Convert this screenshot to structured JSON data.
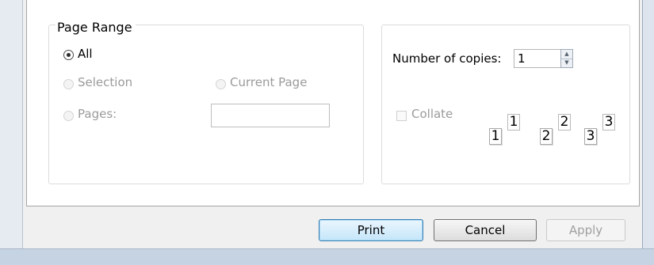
{
  "dialog": {
    "page_range": {
      "title": "Page Range",
      "options": {
        "all": "All",
        "selection": "Selection",
        "current_page": "Current Page",
        "pages": "Pages:"
      },
      "selected": "all",
      "pages_value": ""
    },
    "copies": {
      "label": "Number of copies:",
      "value": "1",
      "collate_label": "Collate",
      "collate_checked": false,
      "collate_pages": [
        "1",
        "1",
        "2",
        "2",
        "3",
        "3"
      ]
    },
    "buttons": {
      "print": "Print",
      "cancel": "Cancel",
      "apply": "Apply"
    }
  }
}
